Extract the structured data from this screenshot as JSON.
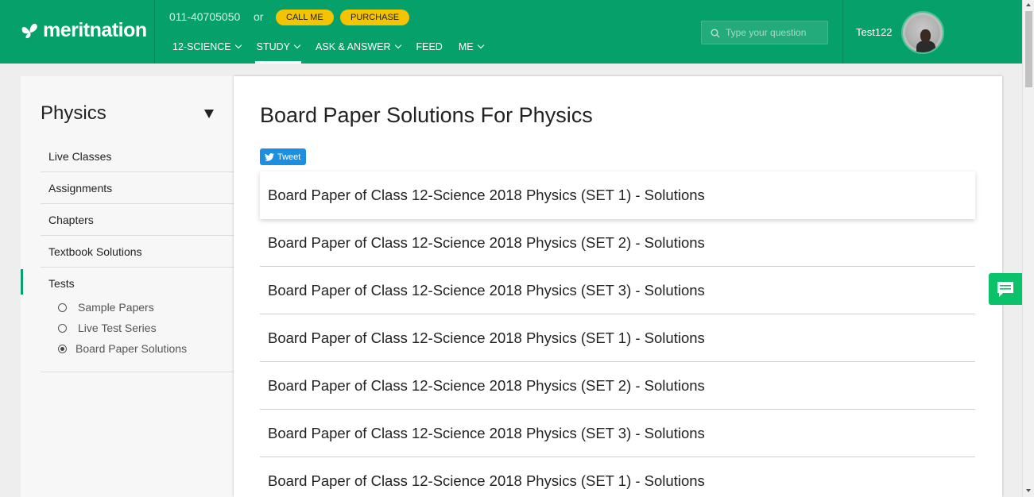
{
  "header": {
    "brand": "meritnation",
    "phone": "011-40705050",
    "or": "or",
    "call_me": "CALL ME",
    "purchase": "PURCHASE",
    "nav": [
      {
        "label": "12-SCIENCE",
        "has_dropdown": true
      },
      {
        "label": "STUDY",
        "has_dropdown": true,
        "active": true
      },
      {
        "label": "ASK & ANSWER",
        "has_dropdown": true
      },
      {
        "label": "FEED",
        "has_dropdown": false
      },
      {
        "label": "ME",
        "has_dropdown": true
      }
    ],
    "search_placeholder": "Type your question",
    "username": "Test122"
  },
  "sidebar": {
    "subject": "Physics",
    "items": [
      "Live Classes",
      "Assignments",
      "Chapters",
      "Textbook Solutions",
      "Tests"
    ],
    "tests_sub": [
      {
        "label": "Sample Papers",
        "checked": false
      },
      {
        "label": "Live Test Series",
        "checked": false
      },
      {
        "label": "Board Paper Solutions",
        "checked": true
      }
    ]
  },
  "main": {
    "title": "Board Paper Solutions For Physics",
    "tweet": "Tweet",
    "rows": [
      "Board Paper of Class 12-Science 2018 Physics (SET 1) - Solutions",
      "Board Paper of Class 12-Science 2018 Physics (SET 2) - Solutions",
      "Board Paper of Class 12-Science 2018 Physics (SET 3) - Solutions",
      "Board Paper of Class 12-Science 2018 Physics (SET 1) - Solutions",
      "Board Paper of Class 12-Science 2018 Physics (SET 2) - Solutions",
      "Board Paper of Class 12-Science 2018 Physics (SET 3) - Solutions",
      "Board Paper of Class 12-Science 2018 Physics (SET 1) - Solutions"
    ]
  },
  "colors": {
    "brand_green": "#06a06a",
    "pill_yellow": "#f5c400",
    "tweet_blue": "#1d8fe0",
    "chat_green": "#0ac26a"
  }
}
